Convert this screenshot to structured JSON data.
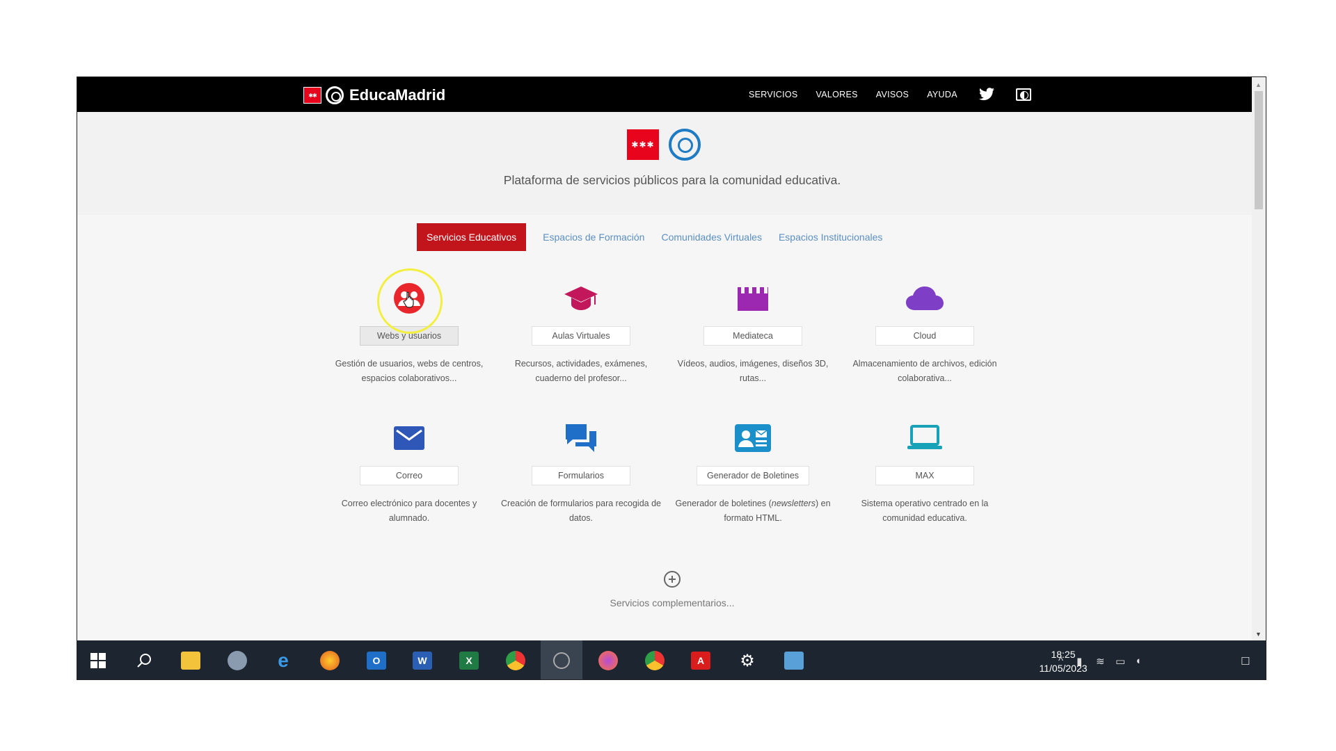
{
  "navbar": {
    "brand_name": "EducaMadrid",
    "links": [
      "SERVICIOS",
      "VALORES",
      "AVISOS",
      "AYUDA"
    ]
  },
  "header": {
    "tagline": "Plataforma de servicios públicos para la comunidad educativa."
  },
  "tabs": [
    {
      "label": "Servicios Educativos",
      "active": true
    },
    {
      "label": "Espacios de Formación",
      "active": false
    },
    {
      "label": "Comunidades Virtuales",
      "active": false
    },
    {
      "label": "Espacios Institucionales",
      "active": false
    }
  ],
  "services": [
    {
      "label": "Webs y usuarios",
      "desc": "Gestión de usuarios, webs de centros, espacios colaborativos...",
      "icon": "users-icon",
      "color": "#e8262b"
    },
    {
      "label": "Aulas Virtuales",
      "desc": "Recursos, actividades, exámenes, cuaderno del profesor...",
      "icon": "graduation-cap-icon",
      "color": "#c2185b"
    },
    {
      "label": "Mediateca",
      "desc": "Vídeos, audios, imágenes, diseños 3D, rutas...",
      "icon": "clapperboard-icon",
      "color": "#9c27b0"
    },
    {
      "label": "Cloud",
      "desc": "Almacenamiento de archivos, edición colaborativa...",
      "icon": "cloud-icon",
      "color": "#7e3fc6"
    },
    {
      "label": "Correo",
      "desc": "Correo electrónico para docentes y alumnado.",
      "icon": "envelope-icon",
      "color": "#2f57b8"
    },
    {
      "label": "Formularios",
      "desc": "Creación de formularios para recogida de datos.",
      "icon": "chat-bubbles-icon",
      "color": "#1f6fc9"
    },
    {
      "label": "Generador de Boletines",
      "desc_pre": "Generador de boletines (",
      "desc_em": "newsletters",
      "desc_post": ") en formato HTML.",
      "icon": "contact-card-icon",
      "color": "#1b8fc9"
    },
    {
      "label": "MAX",
      "desc": "Sistema operativo centrado en la comunidad educativa.",
      "icon": "laptop-icon",
      "color": "#17a2b8"
    }
  ],
  "more": {
    "label": "Servicios complementarios..."
  },
  "taskbar": {
    "time": "18:25",
    "date": "11/05/2023",
    "apps": [
      "windows-start-icon",
      "search-icon",
      "file-explorer-icon",
      "app-icon",
      "internet-explorer-icon",
      "firefox-icon",
      "outlook-icon",
      "word-icon",
      "excel-icon",
      "chrome-icon",
      "recorder-icon",
      "firefox-dev-icon",
      "chrome-alt-icon",
      "acrobat-icon",
      "settings-icon",
      "photos-icon"
    ]
  },
  "colors": {
    "accent_red": "#c2141b",
    "tab_link": "#5b8fc2",
    "navbar": "#000000",
    "taskbar": "#1c2530"
  }
}
